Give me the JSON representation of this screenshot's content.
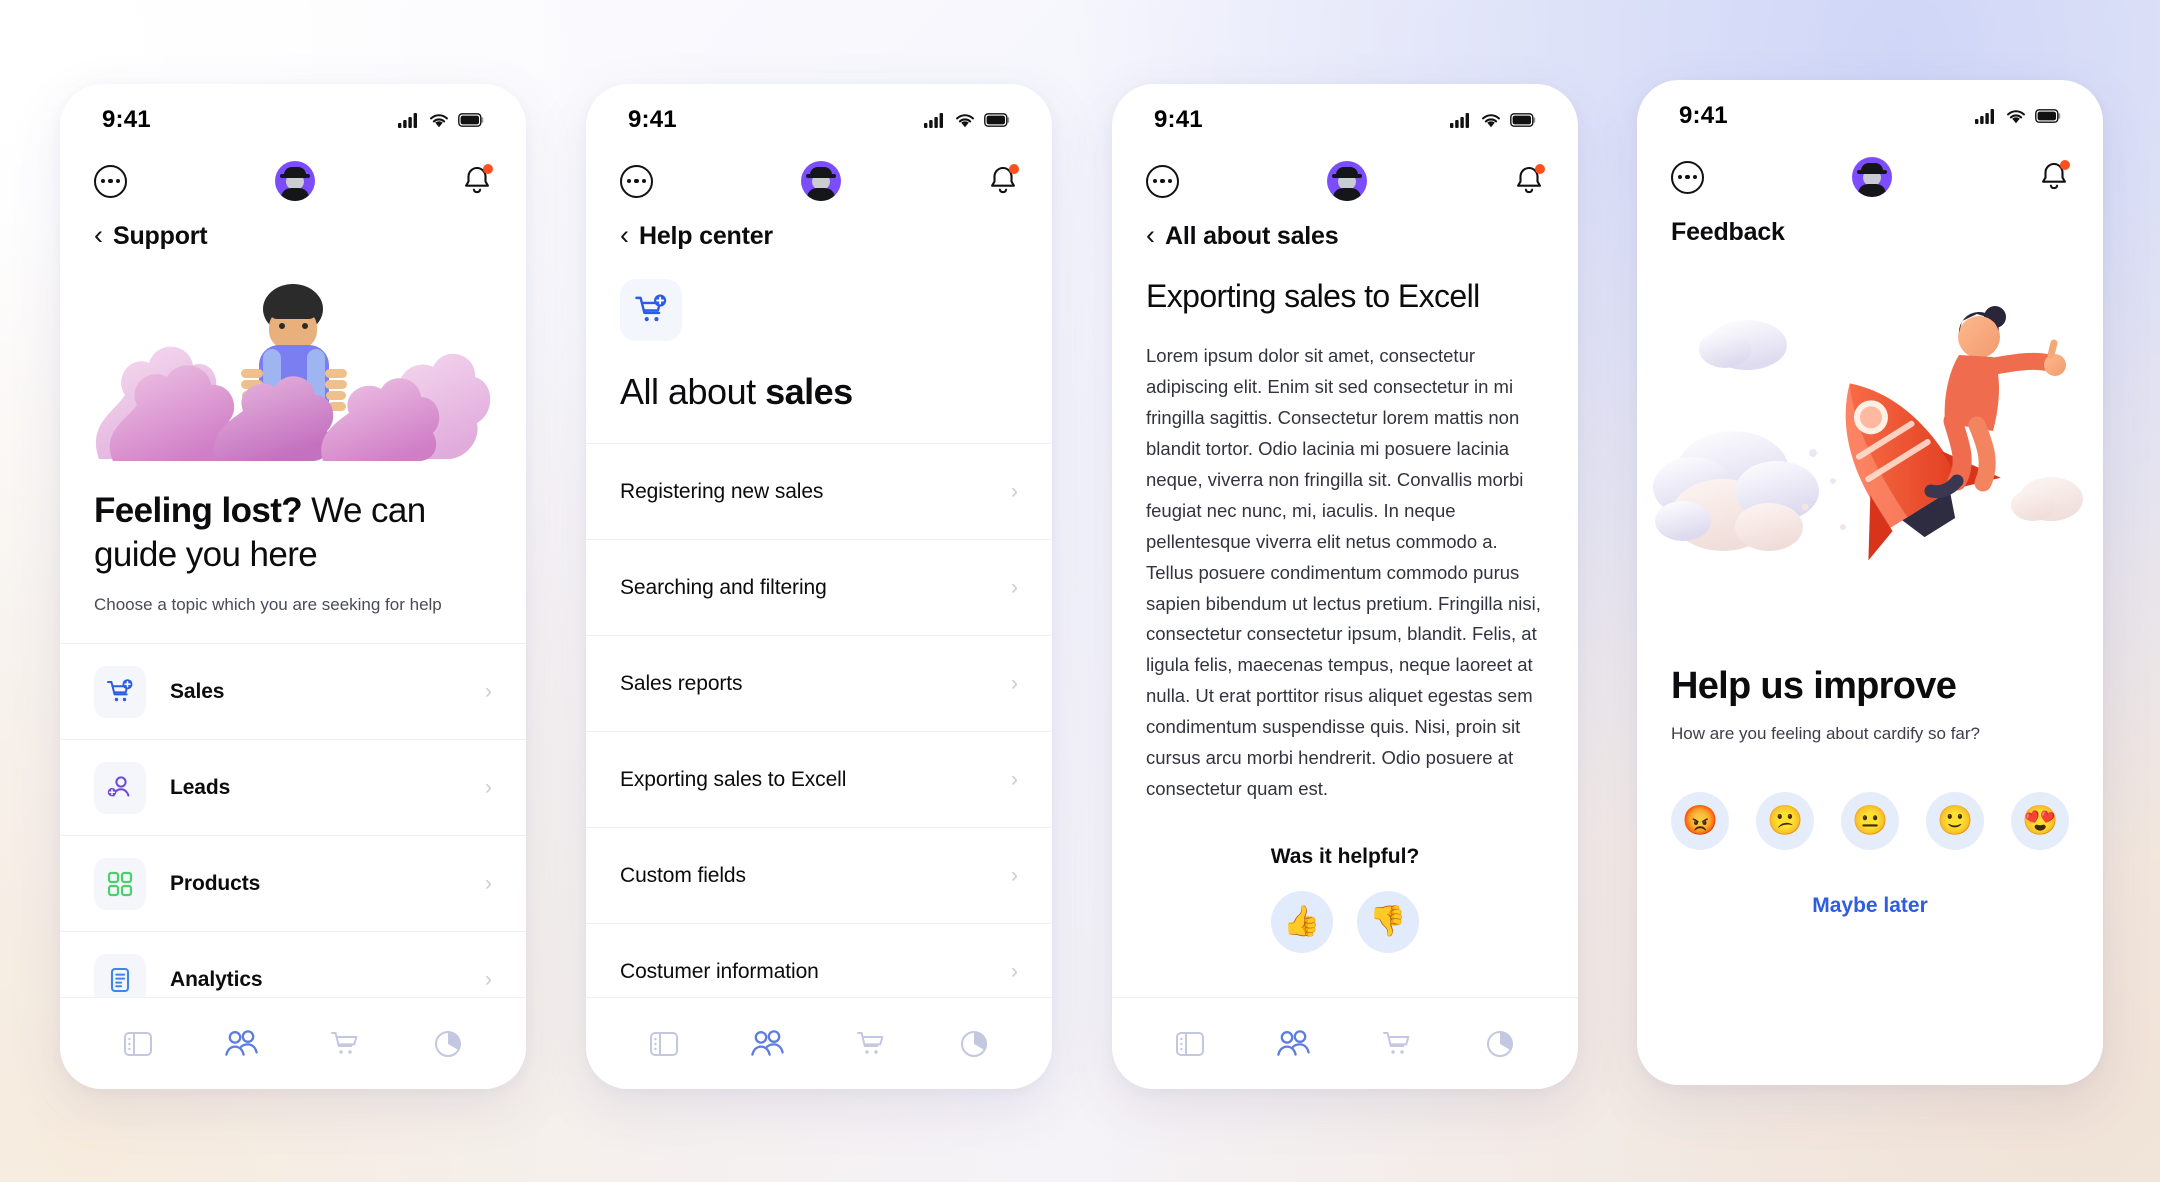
{
  "status_bar": {
    "time": "9:41",
    "signal_icon": "cellular-signal-icon",
    "wifi_icon": "wifi-icon",
    "battery_icon": "battery-icon"
  },
  "app_bar": {
    "menu_icon": "more-options-icon",
    "avatar_icon": "user-avatar",
    "bell_icon": "notification-bell-icon"
  },
  "colors": {
    "accent_blue": "#2f5ce0",
    "cart_blue": "#2b5ce6",
    "leads_purple": "#6b4bd8",
    "products_green": "#4bcf6d",
    "analytics_blue": "#3f86e8",
    "nav_active": "#5c7ce0",
    "nav_inactive": "#c3c8e0",
    "bell_dot": "#ff4f1f",
    "avatar_bg": "#7c4dff"
  },
  "screen1": {
    "title": "Support",
    "back_icon": "chevron-left-icon",
    "headline_bold": "Feeling lost?",
    "headline_rest": " We can guide you here",
    "subline": "Choose a topic which you are seeking for help",
    "illustration": "lost-person-in-bushes-illustration",
    "rows": [
      {
        "label": "Sales",
        "icon": "shopping-cart-add-icon",
        "chevron": "›"
      },
      {
        "label": "Leads",
        "icon": "person-add-icon",
        "chevron": "›"
      },
      {
        "label": "Products",
        "icon": "grid-squares-icon",
        "chevron": "›"
      },
      {
        "label": "Analytics",
        "icon": "document-chart-icon",
        "chevron": "›"
      }
    ]
  },
  "screen2": {
    "title": "Help center",
    "back_icon": "chevron-left-icon",
    "category_icon": "shopping-cart-add-icon",
    "cat_title_rest": "All about ",
    "cat_title_bold": "sales",
    "rows": [
      {
        "label": "Registering new sales",
        "chevron": "›"
      },
      {
        "label": "Searching and filtering",
        "chevron": "›"
      },
      {
        "label": "Sales reports",
        "chevron": "›"
      },
      {
        "label": "Exporting sales to Excell",
        "chevron": "›"
      },
      {
        "label": "Custom fields",
        "chevron": "›"
      },
      {
        "label": "Costumer information",
        "chevron": "›"
      }
    ]
  },
  "screen3": {
    "title": "All about sales",
    "back_icon": "chevron-left-icon",
    "article_title": "Exporting sales to Excell",
    "article_body": "Lorem ipsum dolor sit amet, consectetur adipiscing elit. Enim sit sed consectetur in mi fringilla sagittis. Consectetur lorem mattis non blandit tortor. Odio lacinia mi posuere lacinia neque, viverra non fringilla sit. Convallis morbi feugiat nec nunc, mi, iaculis. In neque pellentesque viverra elit netus commodo a. Tellus posuere condimentum commodo purus sapien bibendum ut lectus pretium. Fringilla nisi, consectetur consectetur ipsum, blandit. Felis, at ligula felis, maecenas tempus, neque laoreet at nulla. Ut erat porttitor risus aliquet egestas sem condimentum suspendisse quis. Nisi, proin sit cursus arcu morbi hendrerit. Odio posuere at consectetur quam est.",
    "helpful_question": "Was it helpful?",
    "thumbs_up": "👍",
    "thumbs_down": "👎",
    "thumbs_up_icon": "thumbs-up-icon",
    "thumbs_down_icon": "thumbs-down-icon"
  },
  "screen4": {
    "title": "Feedback",
    "illustration": "person-riding-rocket-illustration",
    "fb_title": "Help us improve",
    "fb_sub": "How are you feeling about cardify so far?",
    "emojis": [
      {
        "glyph": "😡",
        "name": "angry-face-emoji"
      },
      {
        "glyph": "😕",
        "name": "confused-face-emoji"
      },
      {
        "glyph": "😐",
        "name": "neutral-face-emoji"
      },
      {
        "glyph": "🙂",
        "name": "slightly-smiling-face-emoji"
      },
      {
        "glyph": "😍",
        "name": "heart-eyes-face-emoji"
      }
    ],
    "maybe_later": "Maybe later"
  },
  "bottom_nav": {
    "items": [
      {
        "icon": "dashboard-panel-icon",
        "active": false
      },
      {
        "icon": "people-icon",
        "active": true
      },
      {
        "icon": "shopping-cart-icon",
        "active": false
      },
      {
        "icon": "pie-chart-icon",
        "active": false
      }
    ]
  }
}
